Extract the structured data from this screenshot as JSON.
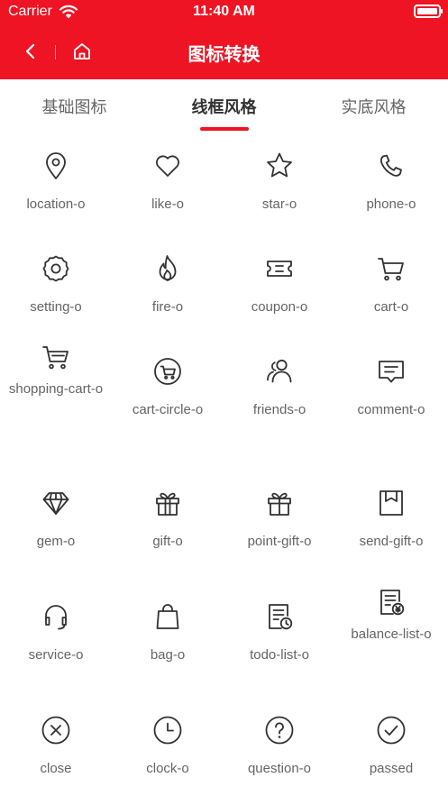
{
  "status_bar": {
    "carrier": "Carrier",
    "time": "11:40 AM"
  },
  "nav": {
    "title": "图标转换",
    "back_icon": "chevron-left-icon",
    "home_icon": "home-icon"
  },
  "tabs": [
    {
      "label": "基础图标",
      "active": false
    },
    {
      "label": "线框风格",
      "active": true
    },
    {
      "label": "实底风格",
      "active": false
    }
  ],
  "accent_color": "#ee1423",
  "icons": [
    {
      "label": "location-o",
      "icon": "location-icon"
    },
    {
      "label": "like-o",
      "icon": "heart-icon"
    },
    {
      "label": "star-o",
      "icon": "star-icon"
    },
    {
      "label": "phone-o",
      "icon": "phone-icon"
    },
    {
      "label": "setting-o",
      "icon": "gear-icon"
    },
    {
      "label": "fire-o",
      "icon": "fire-icon"
    },
    {
      "label": "coupon-o",
      "icon": "coupon-icon"
    },
    {
      "label": "cart-o",
      "icon": "cart-icon"
    },
    {
      "label": "shopping-cart-o",
      "icon": "shopping-cart-icon"
    },
    {
      "label": "cart-circle-o",
      "icon": "cart-circle-icon"
    },
    {
      "label": "friends-o",
      "icon": "friends-icon"
    },
    {
      "label": "comment-o",
      "icon": "comment-icon"
    },
    {
      "label": "gem-o",
      "icon": "gem-icon"
    },
    {
      "label": "gift-o",
      "icon": "gift-icon"
    },
    {
      "label": "point-gift-o",
      "icon": "point-gift-icon"
    },
    {
      "label": "send-gift-o",
      "icon": "send-gift-icon"
    },
    {
      "label": "service-o",
      "icon": "headset-icon"
    },
    {
      "label": "bag-o",
      "icon": "bag-icon"
    },
    {
      "label": "todo-list-o",
      "icon": "todo-list-icon"
    },
    {
      "label": "balance-list-o",
      "icon": "balance-list-icon"
    },
    {
      "label": "close",
      "icon": "close-icon"
    },
    {
      "label": "clock-o",
      "icon": "clock-icon"
    },
    {
      "label": "question-o",
      "icon": "question-icon"
    },
    {
      "label": "passed",
      "icon": "check-circle-icon"
    }
  ]
}
